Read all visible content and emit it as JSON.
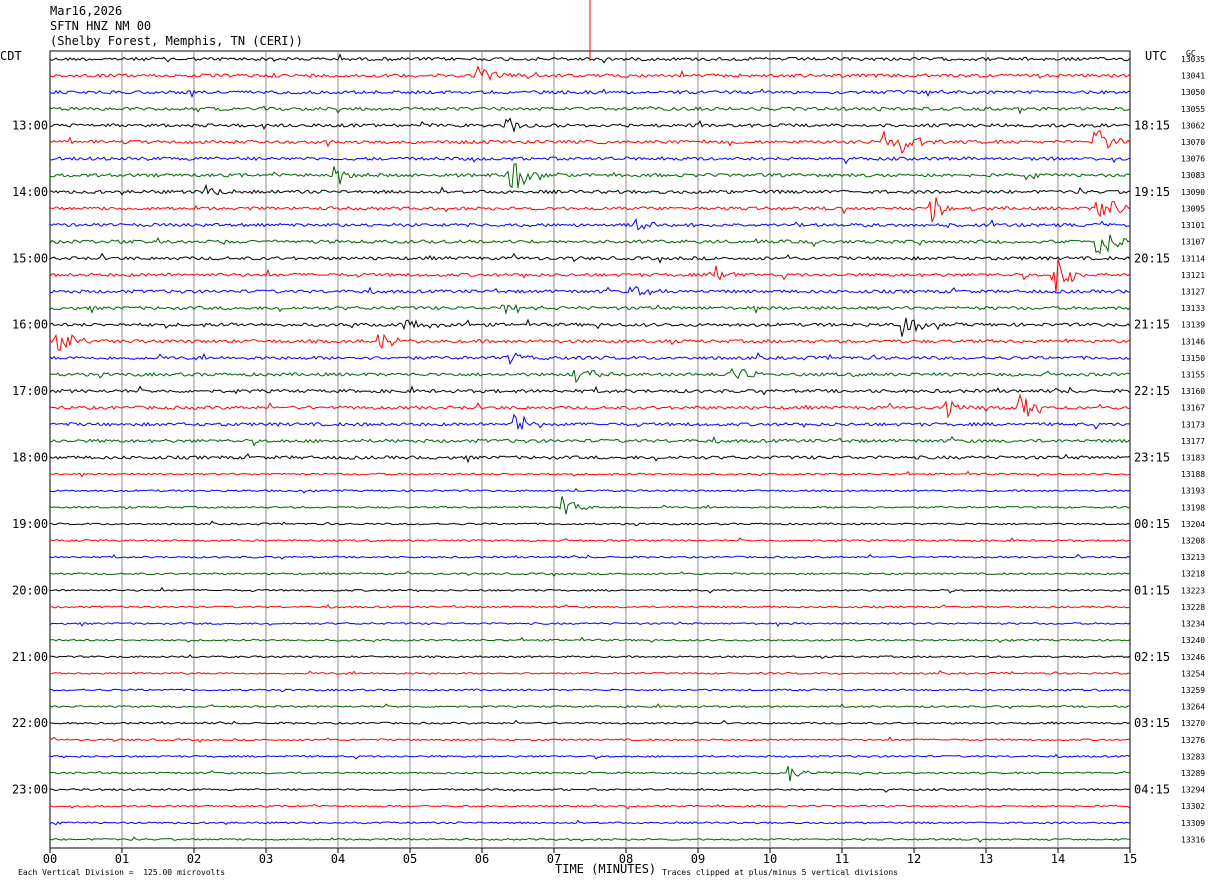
{
  "header": {
    "date": "Mar16,2026",
    "station": "SFTN HNZ NM 00",
    "location": "(Shelby Forest, Memphis, TN (CERI))"
  },
  "left_tz": "CDT",
  "right_tz": "UTC",
  "gc_label": "GC",
  "chart_data": {
    "type": "line",
    "title": "SFTN HNZ NM 00",
    "xlabel": "TIME (MINUTES)",
    "x_ticks": [
      "00",
      "01",
      "02",
      "03",
      "04",
      "05",
      "06",
      "07",
      "08",
      "09",
      "10",
      "11",
      "12",
      "13",
      "14",
      "15"
    ],
    "xlim": [
      0,
      15
    ],
    "rows": 48,
    "trace_colors": [
      "#000000",
      "#ff0000",
      "#0000ff",
      "#006400"
    ],
    "cdt_hour_labels": [
      "13:00",
      "14:00",
      "15:00",
      "16:00",
      "17:00",
      "18:00",
      "19:00",
      "20:00",
      "21:00",
      "22:00",
      "23:00"
    ],
    "utc_hour_labels": [
      "18:15",
      "19:15",
      "20:15",
      "21:15",
      "22:15",
      "23:15",
      "00:15",
      "01:15",
      "02:15",
      "03:15",
      "04:15"
    ],
    "gc_counts": [
      "13035",
      "13041",
      "13050",
      "13055",
      "13062",
      "13070",
      "13076",
      "13083",
      "13090",
      "13095",
      "13101",
      "13107",
      "13114",
      "13121",
      "13127",
      "13133",
      "13139",
      "13146",
      "13150",
      "13155",
      "13160",
      "13167",
      "13173",
      "13177",
      "13183",
      "13188",
      "13193",
      "13198",
      "13204",
      "13208",
      "13213",
      "13218",
      "13223",
      "13228",
      "13234",
      "13240",
      "13246",
      "13254",
      "13259",
      "13264",
      "13270",
      "13276",
      "13283",
      "13289",
      "13294",
      "13302",
      "13309",
      "13316"
    ],
    "events": [
      {
        "row": 1,
        "minute": 5.95,
        "amp": 14
      },
      {
        "row": 4,
        "minute": 6.35,
        "amp": 10
      },
      {
        "row": 5,
        "minute": 11.55,
        "amp": 16
      },
      {
        "row": 5,
        "minute": 11.85,
        "amp": 14
      },
      {
        "row": 5,
        "minute": 14.5,
        "amp": 16
      },
      {
        "row": 7,
        "minute": 3.95,
        "amp": 12
      },
      {
        "row": 7,
        "minute": 6.4,
        "amp": 20
      },
      {
        "row": 8,
        "minute": 2.15,
        "amp": 10
      },
      {
        "row": 9,
        "minute": 12.25,
        "amp": 14
      },
      {
        "row": 9,
        "minute": 14.55,
        "amp": 24
      },
      {
        "row": 10,
        "minute": 8.15,
        "amp": 10
      },
      {
        "row": 11,
        "minute": 14.55,
        "amp": 20
      },
      {
        "row": 13,
        "minute": 9.2,
        "amp": 10
      },
      {
        "row": 13,
        "minute": 13.95,
        "amp": 22
      },
      {
        "row": 14,
        "minute": 8.05,
        "amp": 12
      },
      {
        "row": 15,
        "minute": 6.3,
        "amp": 10
      },
      {
        "row": 16,
        "minute": 4.95,
        "amp": 12
      },
      {
        "row": 16,
        "minute": 11.8,
        "amp": 16
      },
      {
        "row": 17,
        "minute": 0.1,
        "amp": 14
      },
      {
        "row": 17,
        "minute": 4.55,
        "amp": 10
      },
      {
        "row": 18,
        "minute": 6.4,
        "amp": 8
      },
      {
        "row": 19,
        "minute": 7.3,
        "amp": 10
      },
      {
        "row": 19,
        "minute": 9.45,
        "amp": 10
      },
      {
        "row": 21,
        "minute": 13.45,
        "amp": 18
      },
      {
        "row": 21,
        "minute": 12.45,
        "amp": 8
      },
      {
        "row": 22,
        "minute": 6.45,
        "amp": 14
      },
      {
        "row": 27,
        "minute": 7.1,
        "amp": 14
      },
      {
        "row": 43,
        "minute": 10.25,
        "amp": 9
      }
    ]
  },
  "footer": {
    "scale_note": "Each Vertical Division =  125.00 microvolts",
    "clip_note": "Traces clipped at plus/minus 5 vertical divisions"
  }
}
